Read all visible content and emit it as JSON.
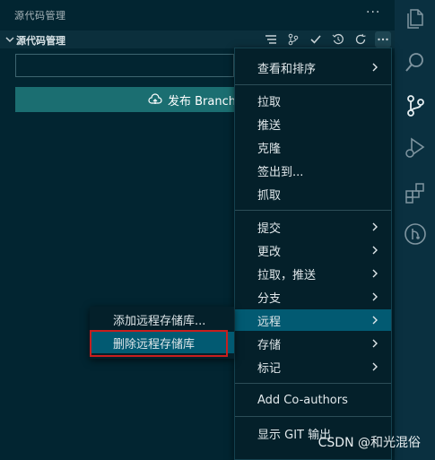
{
  "panel": {
    "title": "源代码管理",
    "more": "···"
  },
  "section": {
    "title": "源代码管理"
  },
  "commit": {
    "placeholder": ""
  },
  "publish": {
    "label": "发布 Branch"
  },
  "main_menu": {
    "items": [
      {
        "label": "查看和排序",
        "submenu": true
      },
      {
        "label": "拉取"
      },
      {
        "label": "推送"
      },
      {
        "label": "克隆"
      },
      {
        "label": "签出到..."
      },
      {
        "label": "抓取"
      },
      {
        "label": "提交",
        "submenu": true
      },
      {
        "label": "更改",
        "submenu": true
      },
      {
        "label": "拉取，推送",
        "submenu": true
      },
      {
        "label": "分支",
        "submenu": true
      },
      {
        "label": "远程",
        "submenu": true,
        "selected": true
      },
      {
        "label": "存储",
        "submenu": true
      },
      {
        "label": "标记",
        "submenu": true
      },
      {
        "label": "Add Co-authors"
      },
      {
        "label": "显示 GIT 输出"
      }
    ]
  },
  "remote_submenu": {
    "items": [
      {
        "label": "添加远程存储库..."
      },
      {
        "label": "删除远程存储库"
      }
    ]
  },
  "watermark": "CSDN @和光混俗",
  "colors": {
    "accent": "#1b6e71",
    "selected": "#025a72",
    "highlight": "#c81e1e"
  }
}
